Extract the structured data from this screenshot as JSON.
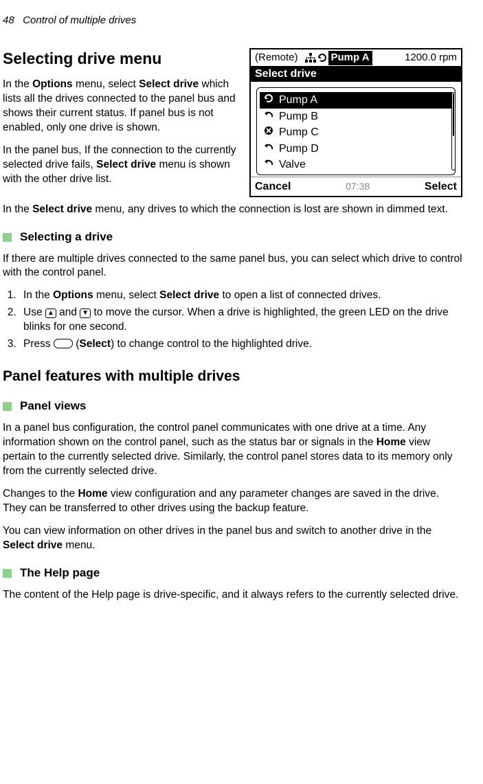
{
  "page_header": {
    "page_num": "48",
    "chapter": "Control of multiple drives"
  },
  "h1a": "Selecting drive menu",
  "p1a": "In the ",
  "p1b": "Options",
  "p1c": " menu, select ",
  "p1d": "Select drive",
  "p1e": " which lists all the drives connected to the panel bus and shows their current status. If panel bus is not enabled, only one drive is shown.",
  "p2a": "In the panel bus, If the connection to the currently selected drive fails, ",
  "p2b": "Select drive",
  "p2c": " menu is shown with the other drive list.",
  "p3a": "In the ",
  "p3b": "Select drive",
  "p3c": " menu, any drives to which the connection is lost are shown in dimmed text.",
  "h3a": "Selecting a drive",
  "p4": "If there are multiple drives connected to the same panel bus, you can select which drive to control with the control panel.",
  "li1a": "In the ",
  "li1b": "Options",
  "li1c": " menu, select ",
  "li1d": "Select drive",
  "li1e": " to open a list of connected drives.",
  "li2a": "Use ",
  "li2b": " and ",
  "li2c": " to move the cursor. When a drive is highlighted, the green LED on the drive blinks for one second.",
  "li3a": "Press ",
  "li3b": " (",
  "li3c": "Select",
  "li3d": ") to change control to the highlighted drive.",
  "h2b": "Panel features with multiple drives",
  "h3b": "Panel views",
  "p5a": "In a panel bus configuration, the control panel communicates with one drive at a time. Any information shown on the control panel, such as the status bar or signals in the ",
  "p5b": "Home",
  "p5c": " view pertain to the currently selected drive. Similarly, the control panel stores data to its memory only from the currently selected drive.",
  "p6a": "Changes to the ",
  "p6b": "Home",
  "p6c": " view configuration and any parameter changes are saved in the drive. They can be transferred to other drives using the backup feature.",
  "p7a": "You can view information on other drives in the panel bus and switch to another drive in the ",
  "p7b": "Select drive",
  "p7c": " menu.",
  "h3c": "The Help page",
  "p8": "The content of the Help page is drive-specific, and it always refers to the currently selected drive.",
  "screenshot": {
    "remote": "(Remote)",
    "badge": "Pump A",
    "rpm": "1200.0 rpm",
    "title": "Select drive",
    "rows": [
      {
        "icon": "rotate",
        "label": "Pump A",
        "selected": true
      },
      {
        "icon": "undo",
        "label": "Pump B",
        "selected": false
      },
      {
        "icon": "stop",
        "label": "Pump C",
        "selected": false
      },
      {
        "icon": "undo",
        "label": "Pump D",
        "selected": false
      },
      {
        "icon": "undo",
        "label": "Valve",
        "selected": false
      }
    ],
    "left": "Cancel",
    "time": "07:38",
    "right": "Select"
  }
}
